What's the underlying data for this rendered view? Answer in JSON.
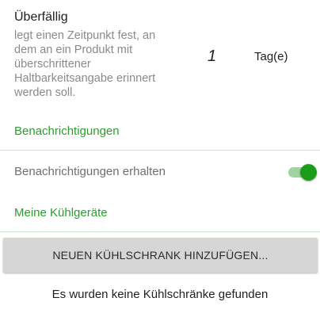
{
  "overdue": {
    "title": "Überfällig",
    "summary": "legt einen Zeitpunkt fest, an dem an ein Produkt mit überschrittener Haltbarkeitsangabe erinnert werden soll.",
    "value": "1",
    "unit": "Tag(e)"
  },
  "notifications": {
    "header": "Benachrichtigungen",
    "switch_label": "Benachrichtigungen erhalten",
    "switch_on": true
  },
  "fridges": {
    "header": "Meine Kühlgeräte",
    "add_button_label": "NEUEN KÜHLSCHRANK HINZUFÜGEN...",
    "empty_message": "Es wurden keine Kühlschränke gefunden"
  },
  "colors": {
    "accent": "#2e9c2e",
    "switch_thumb": "#1b9c1b",
    "switch_track": "#9ed49e",
    "button_bg": "#d6d6d6"
  }
}
